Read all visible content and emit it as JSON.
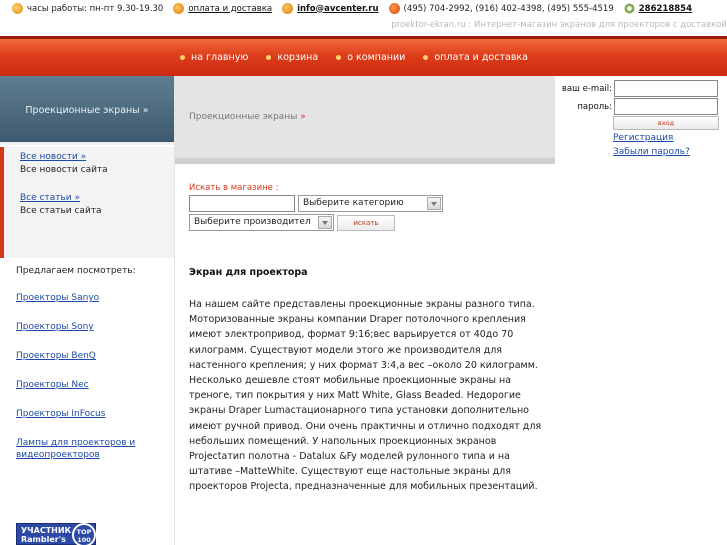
{
  "topbar": {
    "hours": "часы работы: пн-пт 9.30-19.30",
    "delivery_link": "оплата и доставка",
    "email": "info@avcenter.ru",
    "phones": "(495) 704-2992, (916) 402-4398, (495) 555-4519",
    "icq": "286218854"
  },
  "tagline": "proektor-ekran.ru : Интернет-магазин экранов для проекторов с доставкой",
  "nav": {
    "items": [
      "на главную",
      "корзина",
      "о компании",
      "оплата и доставка"
    ]
  },
  "left": {
    "header": "Проекционные экраны »",
    "news_link": "Все новости »",
    "news_sub": "Все новости сайта",
    "articles_link": "Все статьи »",
    "articles_sub": "Все статьи сайта",
    "recommend_title": "Предлагаем посмотреть:",
    "links": [
      "Проекторы Sanyo",
      "Проекторы Sony",
      "Проекторы BenQ",
      "Проекторы Nec",
      "Проекторы InFocus",
      "Лампы для проекторов и видеопроекторов"
    ],
    "badge_text": "УЧАСТНИК",
    "badge_sub": "Rambler's",
    "badge_top": "TOP 100"
  },
  "breadcrumb": {
    "text": "Проекционные экраны",
    "arrow": "»"
  },
  "login": {
    "email_label": "ваш e-mail:",
    "password_label": "пароль:",
    "submit": "вход",
    "register": "Регистрация",
    "forgot": "Забыли пароль?"
  },
  "search": {
    "label": "Искать в магазине :",
    "category": "Выберите категорию",
    "manufacturer": "Выберите производител",
    "button": "искать"
  },
  "article": {
    "title": "Экран для проектора",
    "body": "На нашем сайте представлены проекционные экраны разного типа. Моторизованные экраны компании Draper потолочного крепления имеют электропривод, формат 9:16;вес варьируется от 40до 70 килограмм. Существуют модели этого же производителя для настенного крепления; у них формат 3:4,а вес –около 20 килограмм. Несколько дешевле стоят мобильные проекционные экраны на треноге, тип покрытия у них Matt White, Glass Beaded. Недорогие экраны Draper Lumaстационарного типа установки дополнительно имеют ручной привод. Они очень практичны и отлично подходят для небольших помещений. У напольных проекционных экранов Projectaтип полотна - Datalux &Fy моделей рулонного типа и на штативе –MatteWhite. Существуют еще настольные экраны для проекторов Projecta, предназначенные для мобильных презентаций."
  }
}
